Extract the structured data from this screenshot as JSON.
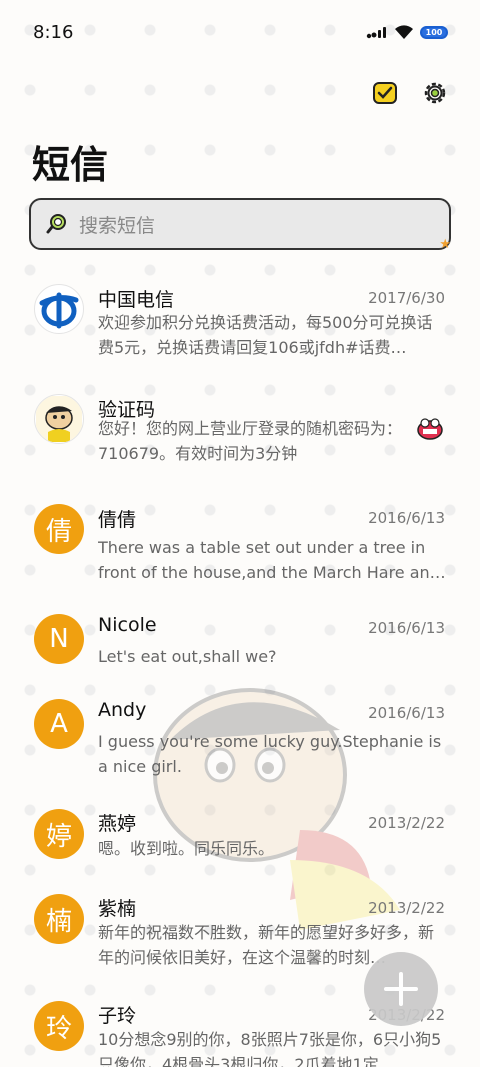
{
  "status": {
    "time": "8:16",
    "battery": "100"
  },
  "header": {
    "title": "短信"
  },
  "search": {
    "placeholder": "搜索短信"
  },
  "messages": [
    {
      "name": "中国电信",
      "date": "2017/6/30",
      "preview": "欢迎参加积分兑换话费活动，每500分可兑换话费5元，兑换话费请回复106或jfdh#话费…",
      "avatar_icon": "china-telecom-logo"
    },
    {
      "name": "验证码",
      "date": "",
      "preview": "您好！您的网上营业厅登录的随机密码为：710679。有效时间为3分钟",
      "avatar_icon": "cartoon-avatar"
    },
    {
      "name": "倩倩",
      "date": "2016/6/13",
      "preview": "There was a table set out under a tree in front of the house,and the March Hare an…",
      "initial": "倩"
    },
    {
      "name": "Nicole",
      "date": "2016/6/13",
      "preview": "Let's eat out,shall we?",
      "initial": "N"
    },
    {
      "name": "Andy",
      "date": "2016/6/13",
      "preview": "I guess you're some lucky guy.Stephanie is a nice girl.",
      "initial": "A"
    },
    {
      "name": "燕婷",
      "date": "2013/2/22",
      "preview": "嗯。收到啦。同乐同乐。",
      "initial": "婷"
    },
    {
      "name": "紫楠",
      "date": "2013/2/22",
      "preview": "新年的祝福数不胜数，新年的愿望好多好多，新年的问候依旧美好，在这个温馨的时刻…",
      "initial": "楠"
    },
    {
      "name": "子玲",
      "date": "2013/2/22",
      "preview": "10分想念9别的你，8张照片7张是你，6只小狗5只像你，4根骨头3根归你，2爪着地1定",
      "initial": "玲"
    }
  ],
  "colors": {
    "accent": "#f0a010",
    "fab": "#c9c9c9"
  }
}
